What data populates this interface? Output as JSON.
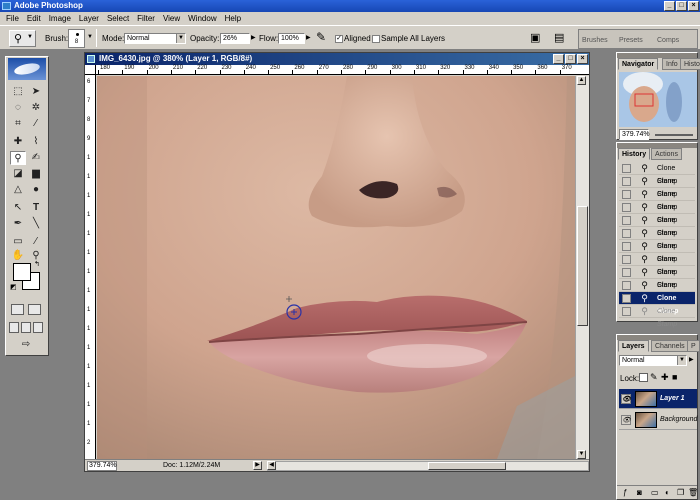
{
  "app": {
    "title": "Adobe Photoshop",
    "window_buttons": [
      "_",
      "□",
      "×"
    ]
  },
  "menu": [
    "File",
    "Edit",
    "Image",
    "Layer",
    "Select",
    "Filter",
    "View",
    "Window",
    "Help"
  ],
  "options": {
    "brush_label": "Brush:",
    "brush_size": "8",
    "mode_label": "Mode:",
    "mode_value": "Normal",
    "opacity_label": "Opacity:",
    "opacity_value": "26%",
    "flow_label": "Flow:",
    "flow_value": "100%",
    "aligned_label": "Aligned",
    "aligned_checked": "✓",
    "sample_all_label": "Sample All Layers",
    "sample_all_checked": "",
    "palette_well_tabs": [
      "Brushes",
      "Presets",
      "Comps"
    ]
  },
  "document": {
    "title": "IMG_6430.jpg @ 380% (Layer 1, RGB/8#)",
    "ruler_h_labels": [
      "180",
      "190",
      "200",
      "210",
      "220",
      "230",
      "240",
      "250",
      "260",
      "270",
      "280",
      "290",
      "300",
      "310",
      "320",
      "330",
      "340",
      "350",
      "360",
      "370"
    ],
    "ruler_v_labels": [
      "6",
      "7",
      "8",
      "9",
      "1",
      "1",
      "1",
      "1",
      "1",
      "1",
      "1",
      "1",
      "1",
      "1",
      "1",
      "1",
      "1",
      "1",
      "1",
      "2"
    ],
    "zoom": "379.74%",
    "doc_size": "Doc: 1.12M/2.24M"
  },
  "navigator": {
    "tabs": [
      "Navigator",
      "Info",
      "Histo"
    ],
    "zoom": "379.74%"
  },
  "history": {
    "tabs": [
      "History",
      "Actions"
    ],
    "items": [
      {
        "label": "Clone Stamp"
      },
      {
        "label": "Clone Stamp"
      },
      {
        "label": "Clone Stamp"
      },
      {
        "label": "Clone Stamp"
      },
      {
        "label": "Clone Stamp"
      },
      {
        "label": "Clone Stamp"
      },
      {
        "label": "Clone Stamp"
      },
      {
        "label": "Clone Stamp"
      },
      {
        "label": "Clone Stamp"
      },
      {
        "label": "Clone Stamp"
      },
      {
        "label": "Clone Stamp"
      },
      {
        "label": "Clone Stamp"
      }
    ],
    "active_index": 10
  },
  "layers": {
    "tabs": [
      "Layers",
      "Channels",
      "P"
    ],
    "blend_mode": "Normal",
    "lock_label": "Lock:",
    "items": [
      {
        "name": "Layer 1",
        "visible": "👁"
      },
      {
        "name": "Background",
        "visible": "👁"
      }
    ]
  },
  "colors": {
    "selection": "#0a246a",
    "chrome": "#d4d0c8",
    "titlebar": "#1747b4"
  }
}
